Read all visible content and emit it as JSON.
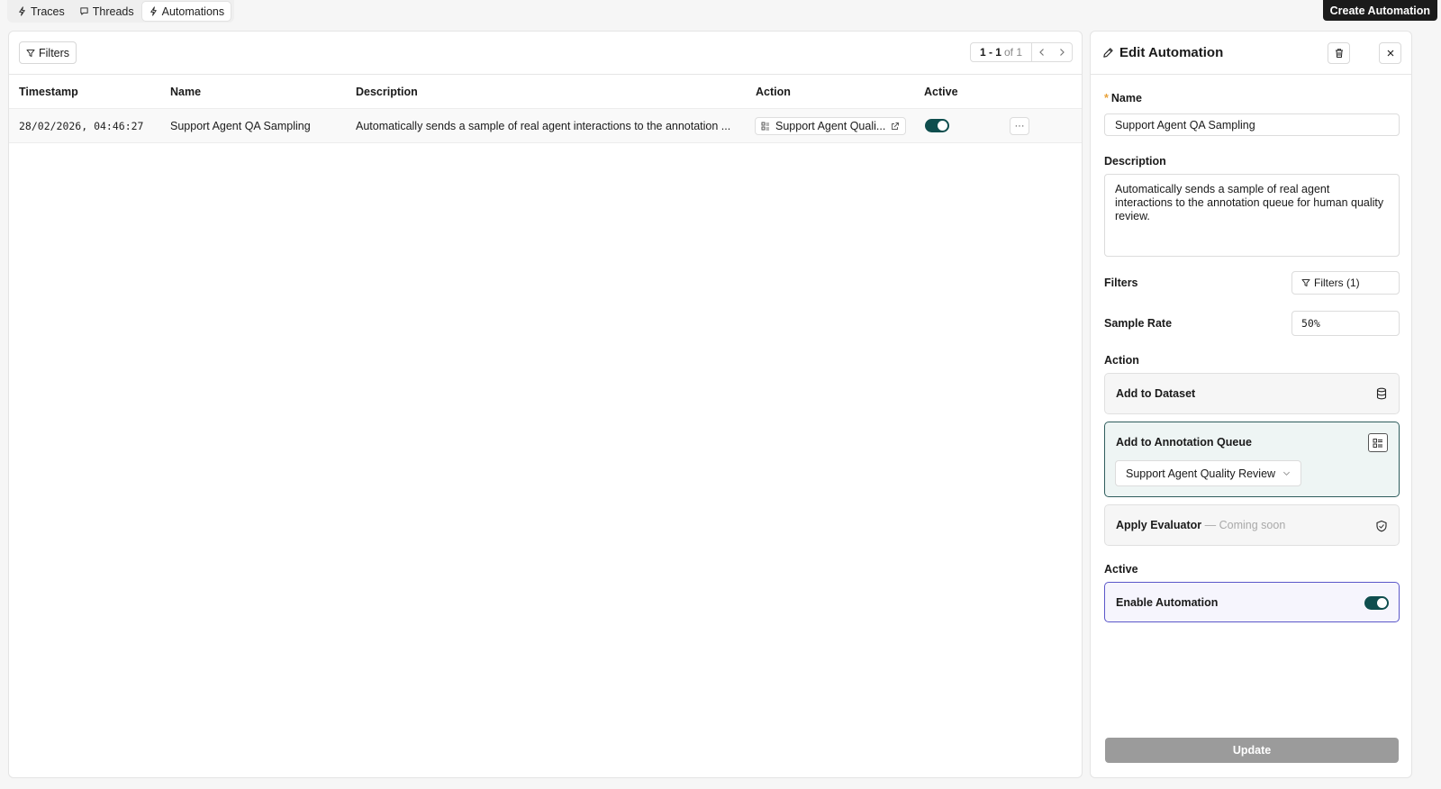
{
  "nav": {
    "tabs": [
      {
        "label": "Traces",
        "icon": "traces-icon"
      },
      {
        "label": "Threads",
        "icon": "threads-icon"
      },
      {
        "label": "Automations",
        "icon": "automations-icon"
      }
    ],
    "create_label": "Create Automation"
  },
  "table": {
    "filters_label": "Filters",
    "pager": {
      "range": "1 - 1",
      "of": "of 1"
    },
    "columns": [
      "Timestamp",
      "Name",
      "Description",
      "Action",
      "Active"
    ],
    "rows": [
      {
        "timestamp": "28/02/2026, 04:46:27",
        "name": "Support Agent QA Sampling",
        "description": "Automatically sends a sample of real agent interactions to the annotation ...",
        "action": "Support Agent Quali...",
        "active": true,
        "more": "···"
      }
    ]
  },
  "panel": {
    "title": "Edit Automation",
    "name_label": "Name",
    "required_mark": "*",
    "name_value": "Support Agent QA Sampling",
    "description_label": "Description",
    "description_value": "Automatically sends a sample of real agent interactions to the annotation queue for human quality review.",
    "filters_label": "Filters",
    "filters_button": "Filters (1)",
    "sample_rate_label": "Sample Rate",
    "sample_rate_value": "50%",
    "action_label": "Action",
    "actions": {
      "dataset": "Add to Dataset",
      "queue": "Add to Annotation Queue",
      "queue_selected": "Support Agent Quality Review",
      "evaluator": "Apply Evaluator",
      "evaluator_note": "— Coming soon"
    },
    "active_label": "Active",
    "enable_label": "Enable Automation",
    "enabled": true,
    "update_label": "Update"
  },
  "colors": {
    "toggle_on": "#0f4e4e",
    "selected_card_border": "#2f5d5d",
    "active_card_border": "#5b57c9",
    "required": "#e8a23a",
    "update_disabled": "#9b9b9b"
  }
}
